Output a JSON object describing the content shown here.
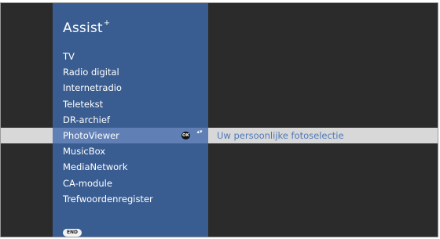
{
  "header": {
    "title": "Assist",
    "title_sup": "+"
  },
  "menu": {
    "items": [
      {
        "label": "TV"
      },
      {
        "label": "Radio digital"
      },
      {
        "label": "Internetradio"
      },
      {
        "label": "Teletekst"
      },
      {
        "label": "DR-archief"
      },
      {
        "label": "PhotoViewer",
        "selected": true,
        "description": "Uw persoonlijke fotoselectie"
      },
      {
        "label": "MusicBox"
      },
      {
        "label": "MediaNetwork"
      },
      {
        "label": "CA-module"
      },
      {
        "label": "Trefwoordenregister"
      }
    ],
    "ok_label": "OK",
    "arrows": "▴▾"
  },
  "footer": {
    "end_label": "END"
  },
  "colors": {
    "panel": "#3a5d91",
    "selected_panel": "#5f7fb5",
    "selected_row": "#d8d8d8",
    "background": "#2b2b2b",
    "description": "#4e78b8"
  }
}
